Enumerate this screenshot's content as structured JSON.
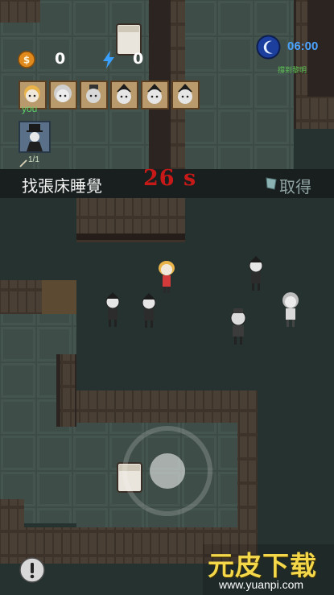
{
  "hud": {
    "coins": "0",
    "energy": "0",
    "clock_time": "06:00",
    "dawn_hint": "撐到黎明",
    "you_label": "you",
    "item_count": "1/1"
  },
  "objective": {
    "text": "找張床睡覺",
    "countdown": "26 s",
    "grab_label": "取得"
  },
  "party_portraits": [
    "survivor-blonde",
    "survivor-white-hair",
    "survivor-bald",
    "survivor-pale-1",
    "survivor-pale-2",
    "survivor-pale-3"
  ],
  "watermark": {
    "title": "元皮下载",
    "url": "www.yuanpi.com"
  },
  "colors": {
    "floor": "#24302d",
    "tile": "#3b4a45",
    "wall": "#3a3028",
    "timer_red": "#c81919",
    "clock_blue": "#4aa3ff",
    "dawn_green": "#5dc454",
    "coin_orange": "#e08a1e"
  },
  "icons": {
    "coin": "coin-icon",
    "energy": "lightning-icon",
    "clock": "moon-clock-icon",
    "alert": "exclamation-icon",
    "grab": "cloth-icon"
  }
}
